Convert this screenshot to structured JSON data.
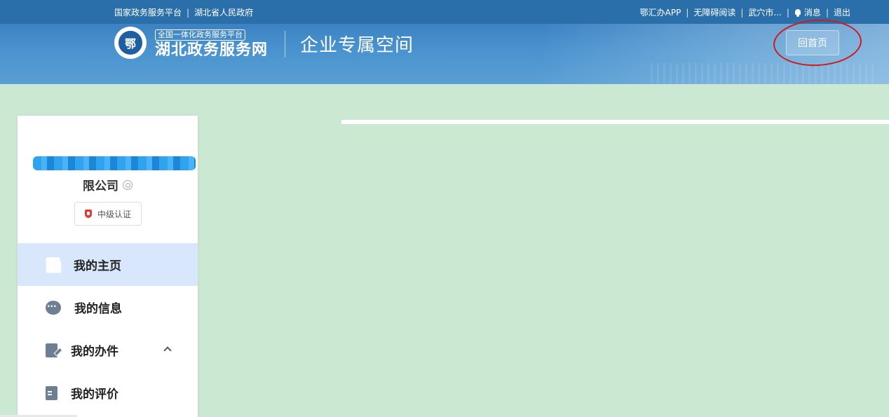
{
  "topbar": {
    "national_platform": "国家政务服务平台",
    "provincial_gov": "湖北省人民政府",
    "app": "鄂汇办APP",
    "accessibility": "无障碍阅读",
    "user": "武穴市...",
    "messages": "消息",
    "logout": "退出",
    "separator": "|"
  },
  "banner": {
    "logo_subtitle": "全国一体化政务服务平台",
    "logo_title": "湖北政务服务网",
    "space_title": "企业专属空间",
    "home_button": "回首页"
  },
  "sidebar": {
    "company_name_suffix": "限公司",
    "certification": "中级认证",
    "menu": [
      {
        "label": "我的主页",
        "icon": "home-icon",
        "active": true
      },
      {
        "label": "我的信息",
        "icon": "chat-icon",
        "active": false
      },
      {
        "label": "我的办件",
        "icon": "doc-edit-icon",
        "active": false,
        "expanded": true
      },
      {
        "label": "我的评价",
        "icon": "doc-icon",
        "active": false
      }
    ]
  },
  "colors": {
    "topbar": "#2a6fa9",
    "page_background": "#cbe8d2",
    "active_menu": "#d8e7fb",
    "annotation": "#d21a1a"
  }
}
